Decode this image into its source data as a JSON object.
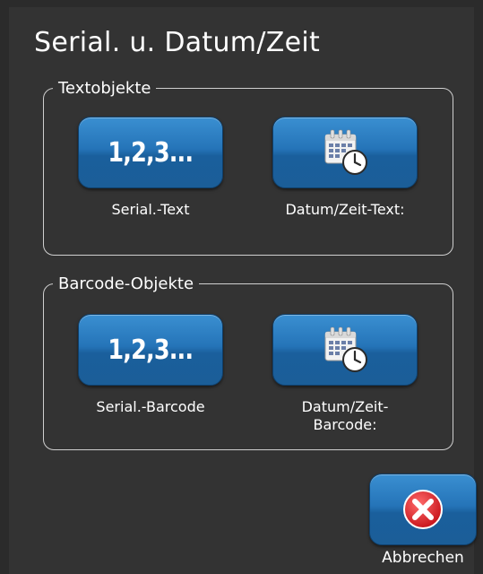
{
  "dialog": {
    "title": "Serial. u. Datum/Zeit"
  },
  "text_objects": {
    "legend": "Textobjekte",
    "serial": {
      "label": "Serial.-Text",
      "icon": "1,2,3..."
    },
    "datetime": {
      "label": "Datum/Zeit-Text:",
      "icon_name": "calendar-clock-icon"
    }
  },
  "barcode_objects": {
    "legend": "Barcode-Objekte",
    "serial": {
      "label": "Serial.-Barcode",
      "icon": "1,2,3..."
    },
    "datetime": {
      "label": "Datum/Zeit-\nBarcode:",
      "icon_name": "calendar-clock-icon"
    }
  },
  "cancel": {
    "label": "Abbrechen",
    "icon_name": "close-icon"
  },
  "colors": {
    "accent": "#2574b8",
    "cancel": "#e8373f",
    "background": "#333333"
  }
}
